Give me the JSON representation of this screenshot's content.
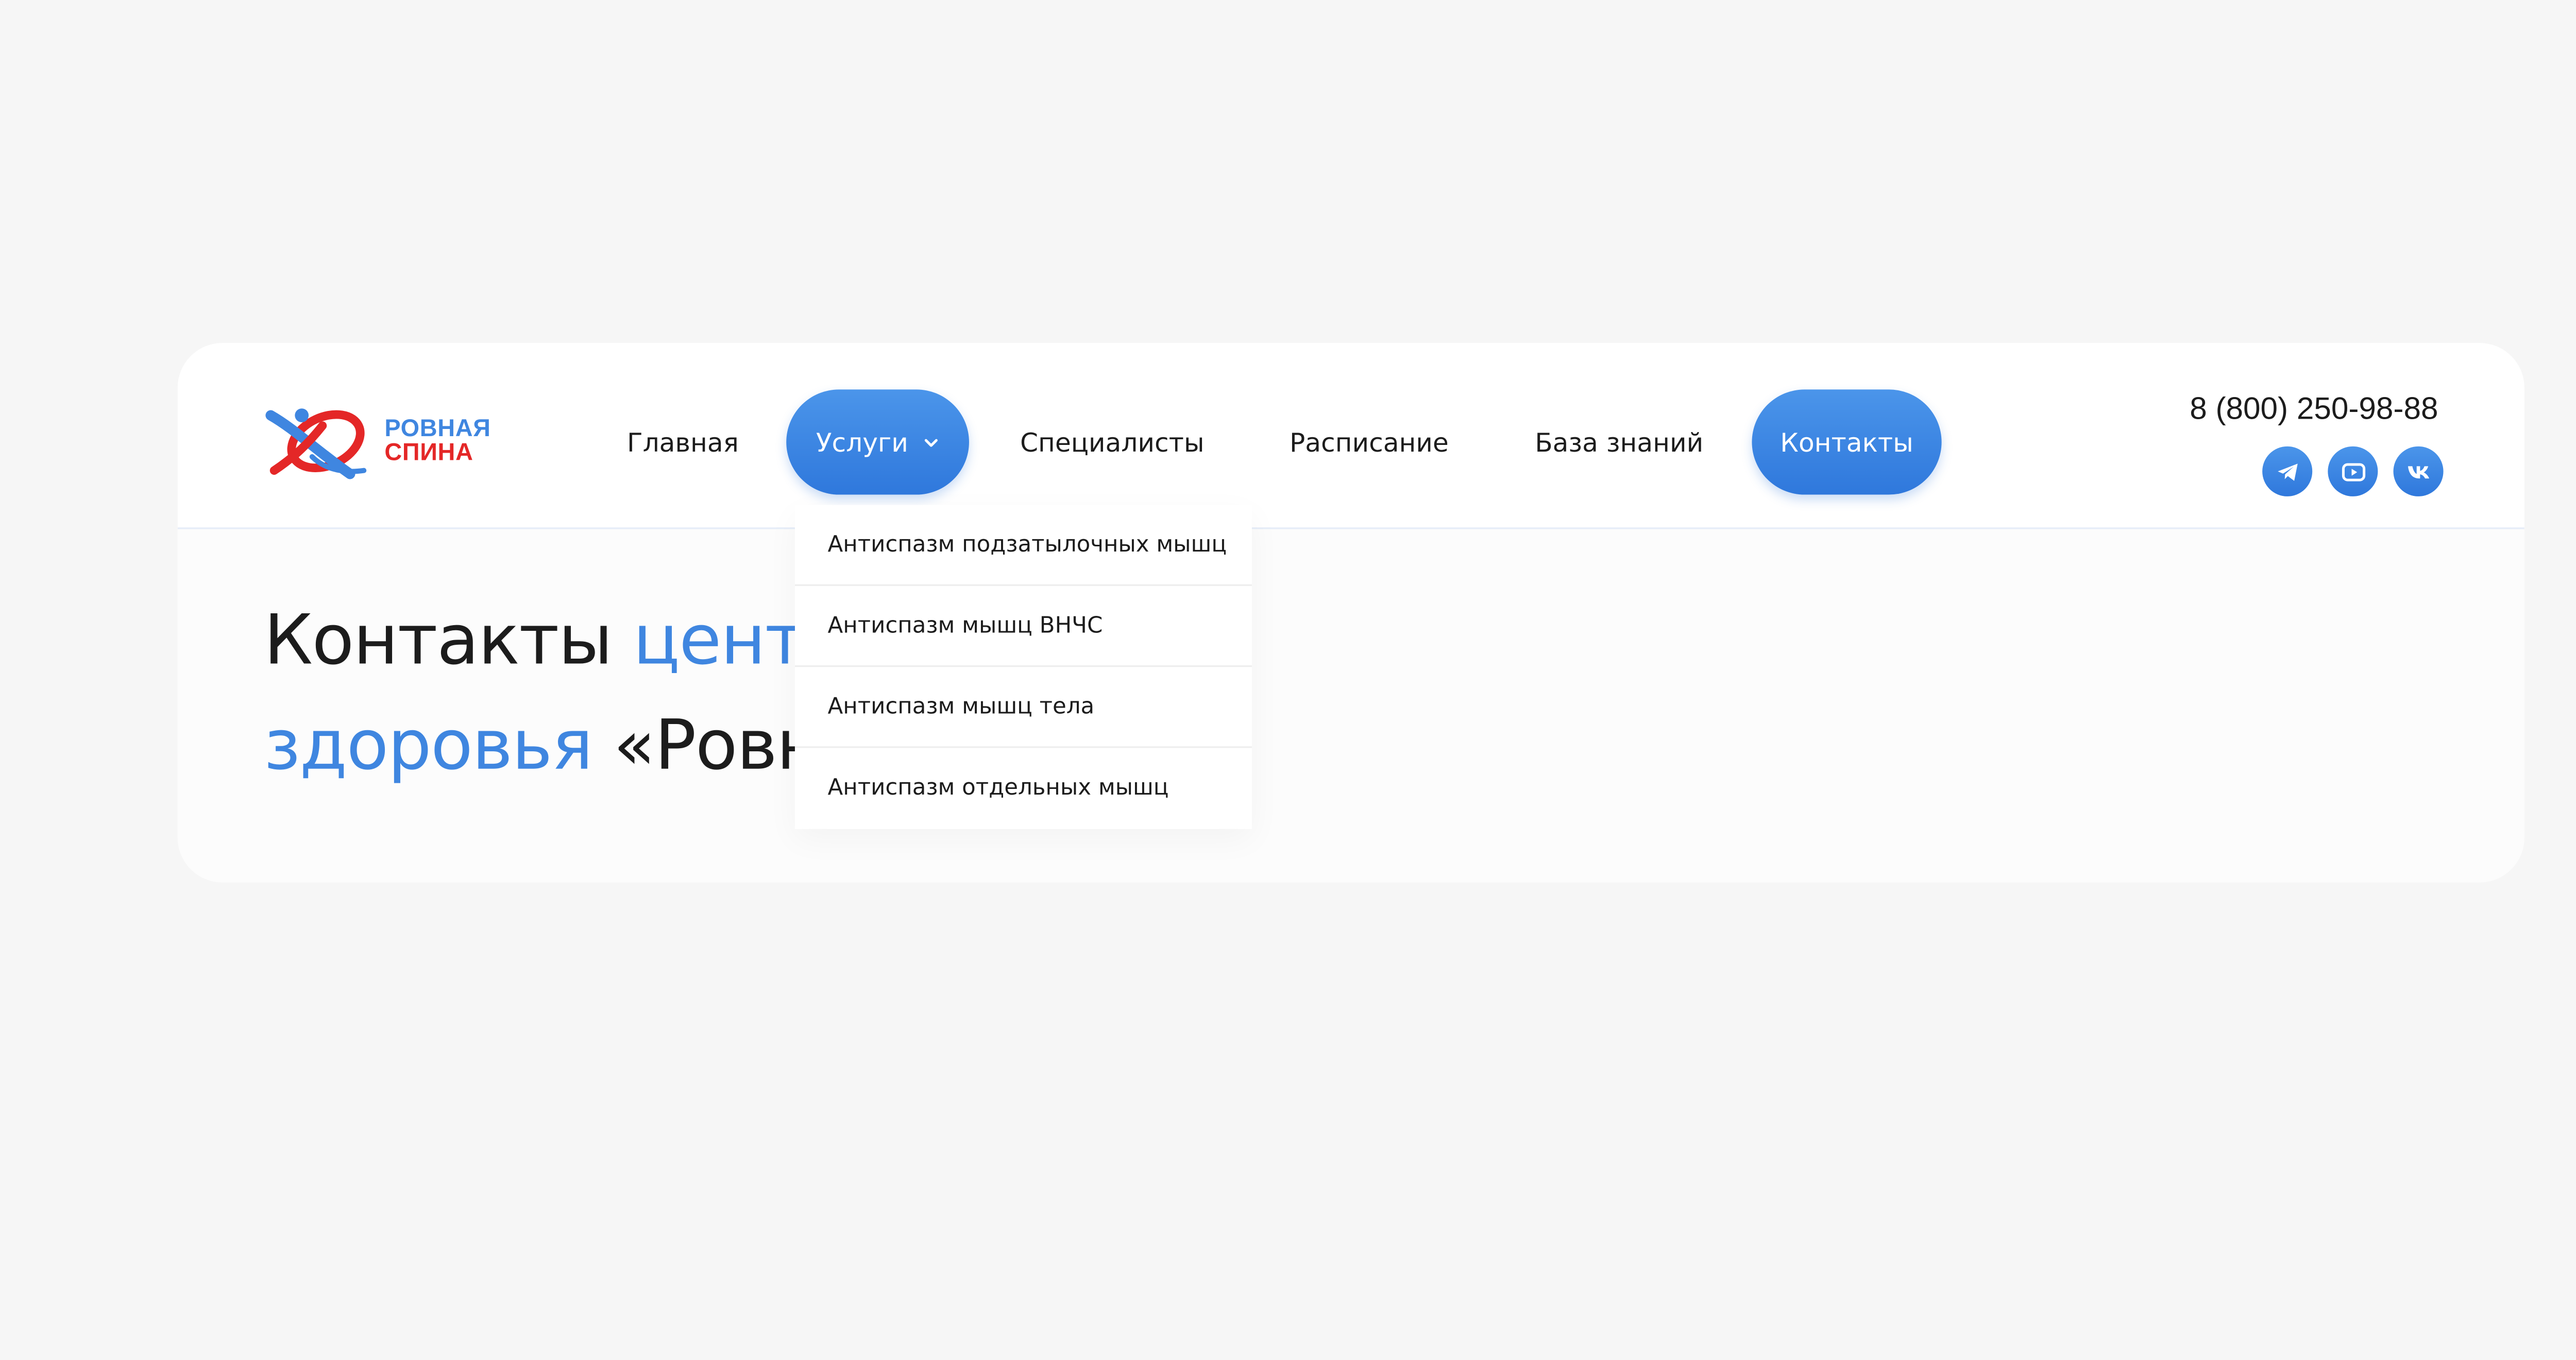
{
  "brand": {
    "line1": "РОВНАЯ",
    "line2": "СПИНА",
    "color_blue": "#3f86e0",
    "color_red": "#e42727"
  },
  "nav": {
    "items": [
      {
        "label": "Главная",
        "active": false
      },
      {
        "label": "Услуги",
        "active": true,
        "has_dropdown": true
      },
      {
        "label": "Специалисты",
        "active": false
      },
      {
        "label": "Расписание",
        "active": false
      },
      {
        "label": "База знаний",
        "active": false
      },
      {
        "label": "Контакты",
        "active": true
      }
    ],
    "accent": "#3f86e0"
  },
  "contacts": {
    "phone": "8 (800) 250-98-88",
    "socials": [
      "telegram-icon",
      "youtube-icon",
      "vk-icon"
    ]
  },
  "dropdown": {
    "items": [
      "Антиспазм подзатылочных мышц",
      "Антиспазм мышц ВНЧС",
      "Антиспазм мышц тела",
      "Антиспазм отдельных мышц"
    ]
  },
  "heading": {
    "part1": "Контакты ",
    "part2": "центра",
    "part3": "здоровья ",
    "part4": "«Ровная спина»"
  }
}
